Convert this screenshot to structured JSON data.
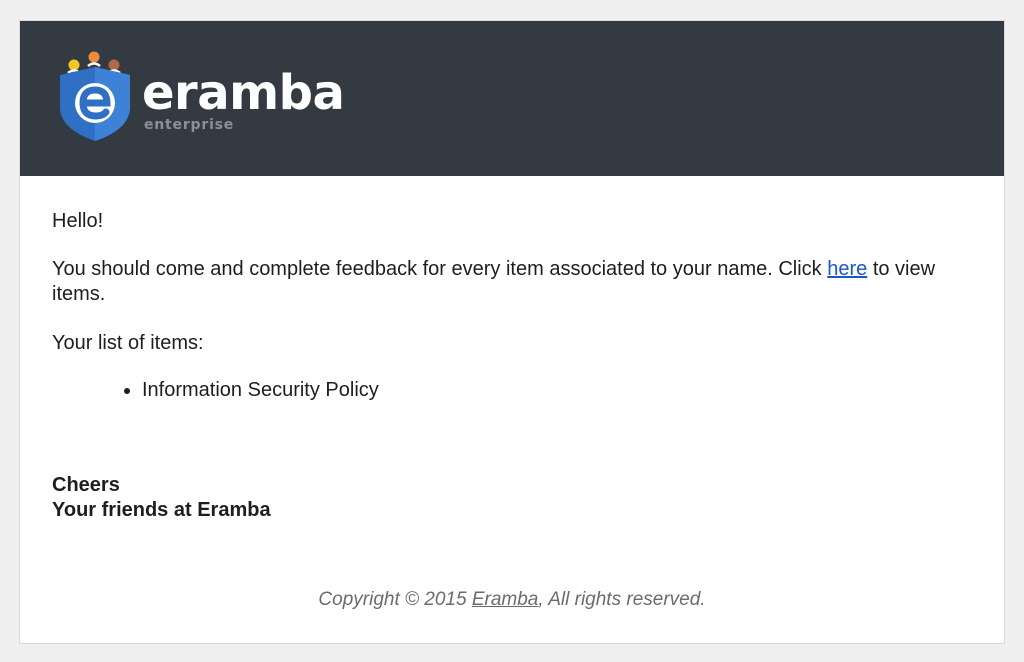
{
  "header": {
    "logo": {
      "wordmark": "eramba",
      "subtitle": "enterprise",
      "icon": "eramba-shield-logo-icon"
    }
  },
  "email": {
    "greeting": "Hello!",
    "message_before_link": "You should come and complete feedback for every item associated to your name. Click ",
    "link_text": "here",
    "message_after_link": " to view items.",
    "list_title": "Your list of items:",
    "items": [
      {
        "label": "Information Security Policy"
      }
    ],
    "signoff_line1": "Cheers",
    "signoff_line2": "Your friends at Eramba"
  },
  "footer": {
    "text_before": "Copyright © 2015 ",
    "link_text": "Eramba",
    "text_after": ", All rights reserved."
  },
  "colors": {
    "header_bg": "#343a42",
    "shield_blue": "#2f6fc4",
    "link_blue": "#1a57c9",
    "dot_yellow": "#f3c623",
    "dot_orange": "#f08a3c",
    "dot_brown": "#b06a45"
  }
}
